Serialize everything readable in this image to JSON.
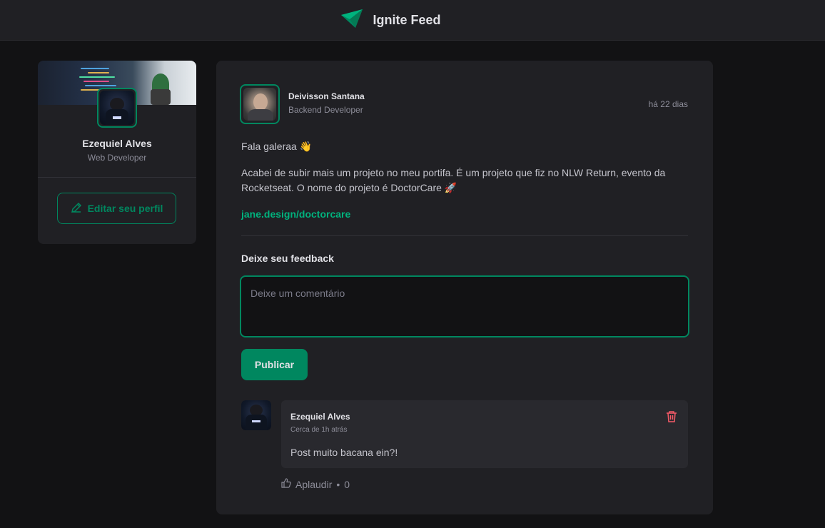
{
  "header": {
    "app_title": "Ignite Feed",
    "logo_icon": "paper-plane-logo"
  },
  "sidebar": {
    "profile_name": "Ezequiel Alves",
    "profile_role": "Web Developer",
    "edit_button": "Editar seu perfil"
  },
  "post": {
    "author_name": "Deivisson Santana",
    "author_role": "Backend Developer",
    "time": "há 22 dias",
    "paragraph_1": "Fala galeraa 👋",
    "paragraph_2": "Acabei de subir mais um projeto no meu portifa. É um projeto que fiz no NLW Return, evento da Rocketseat. O nome do projeto é DoctorCare 🚀",
    "link": "jane.design/doctorcare",
    "feedback_title": "Deixe seu feedback",
    "comment_placeholder": "Deixe um comentário",
    "publish_button": "Publicar"
  },
  "comment": {
    "author": "Ezequiel Alves",
    "time": "Cerca de 1h atrás",
    "text": "Post muito bacana ein?!",
    "applaud_label": "Aplaudir",
    "applaud_separator": "•",
    "applaud_count": "0"
  },
  "colors": {
    "accent": "#00875f",
    "accent_light": "#00b37e",
    "danger": "#f75a68",
    "background": "#121214",
    "surface": "#202024"
  }
}
